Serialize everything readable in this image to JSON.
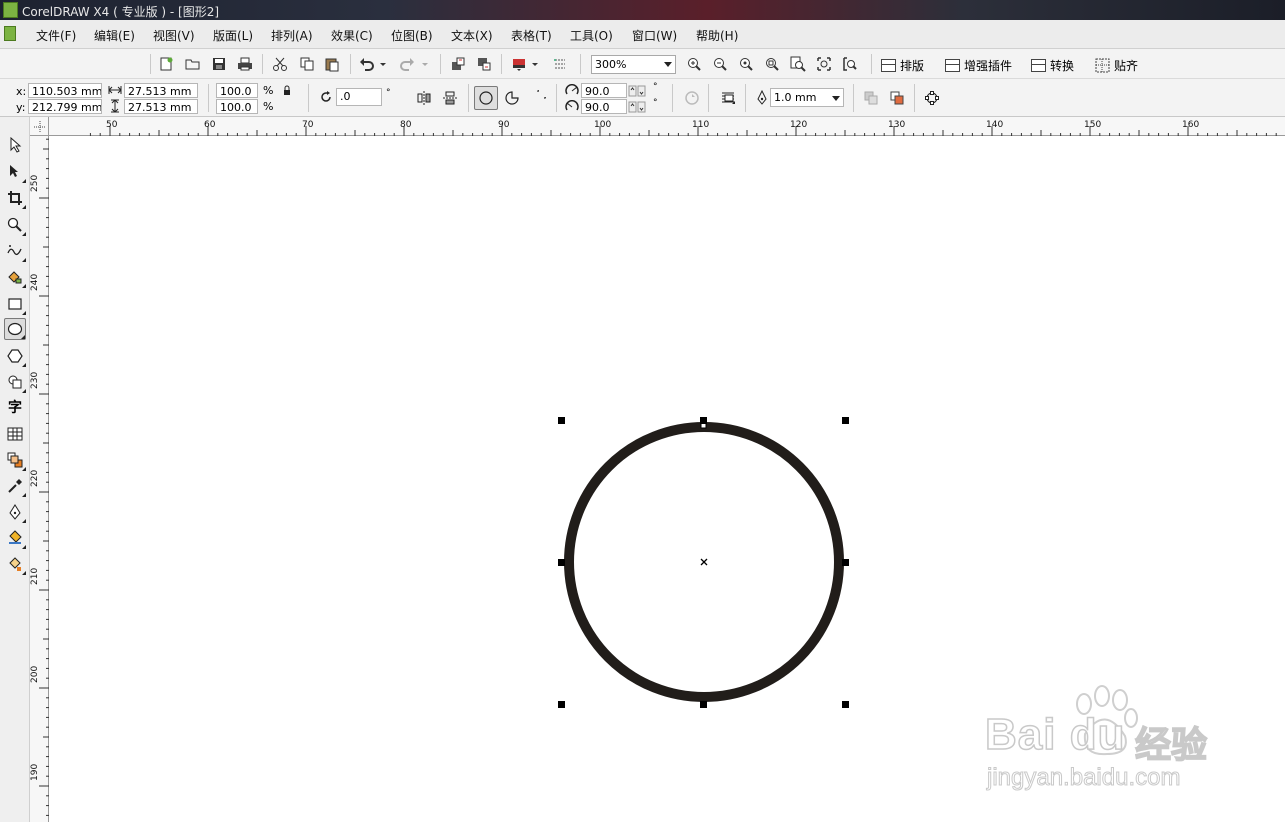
{
  "window": {
    "title": "CorelDRAW X4 ( 专业版 ) - [图形2]"
  },
  "menu": {
    "items": [
      "文件(F)",
      "编辑(E)",
      "视图(V)",
      "版面(L)",
      "排列(A)",
      "效果(C)",
      "位图(B)",
      "文本(X)",
      "表格(T)",
      "工具(O)",
      "窗口(W)",
      "帮助(H)"
    ]
  },
  "toolbar": {
    "zoom": "300%",
    "plugins": [
      "排版",
      "增强插件",
      "转换",
      "贴齐"
    ]
  },
  "property_bar": {
    "x_label": "x:",
    "y_label": "y:",
    "x": "110.503 mm",
    "y": "212.799 mm",
    "width": "27.513 mm",
    "height": "27.513 mm",
    "scale_x": "100.0",
    "scale_y": "100.0",
    "percent": "%",
    "rotation": ".0",
    "degree": "°",
    "start_angle": "90.0",
    "end_angle": "90.0",
    "outline_width": "1.0 mm"
  },
  "rulers": {
    "top_labels": [
      "50",
      "60",
      "70",
      "80",
      "90",
      "100",
      "110",
      "120",
      "130",
      "140",
      "150",
      "160"
    ],
    "left_labels": [
      "250",
      "240",
      "230",
      "220",
      "210",
      "200",
      "190"
    ]
  },
  "toolbox": {
    "text_tool_glyph": "字",
    "active_tool": "ellipse-tool"
  },
  "watermark": {
    "brand": "Bai du",
    "cn": "经验",
    "url": "jingyan.baidu.com"
  },
  "colors": {
    "circle_outline": "#211d1a",
    "handle": "#000000"
  }
}
